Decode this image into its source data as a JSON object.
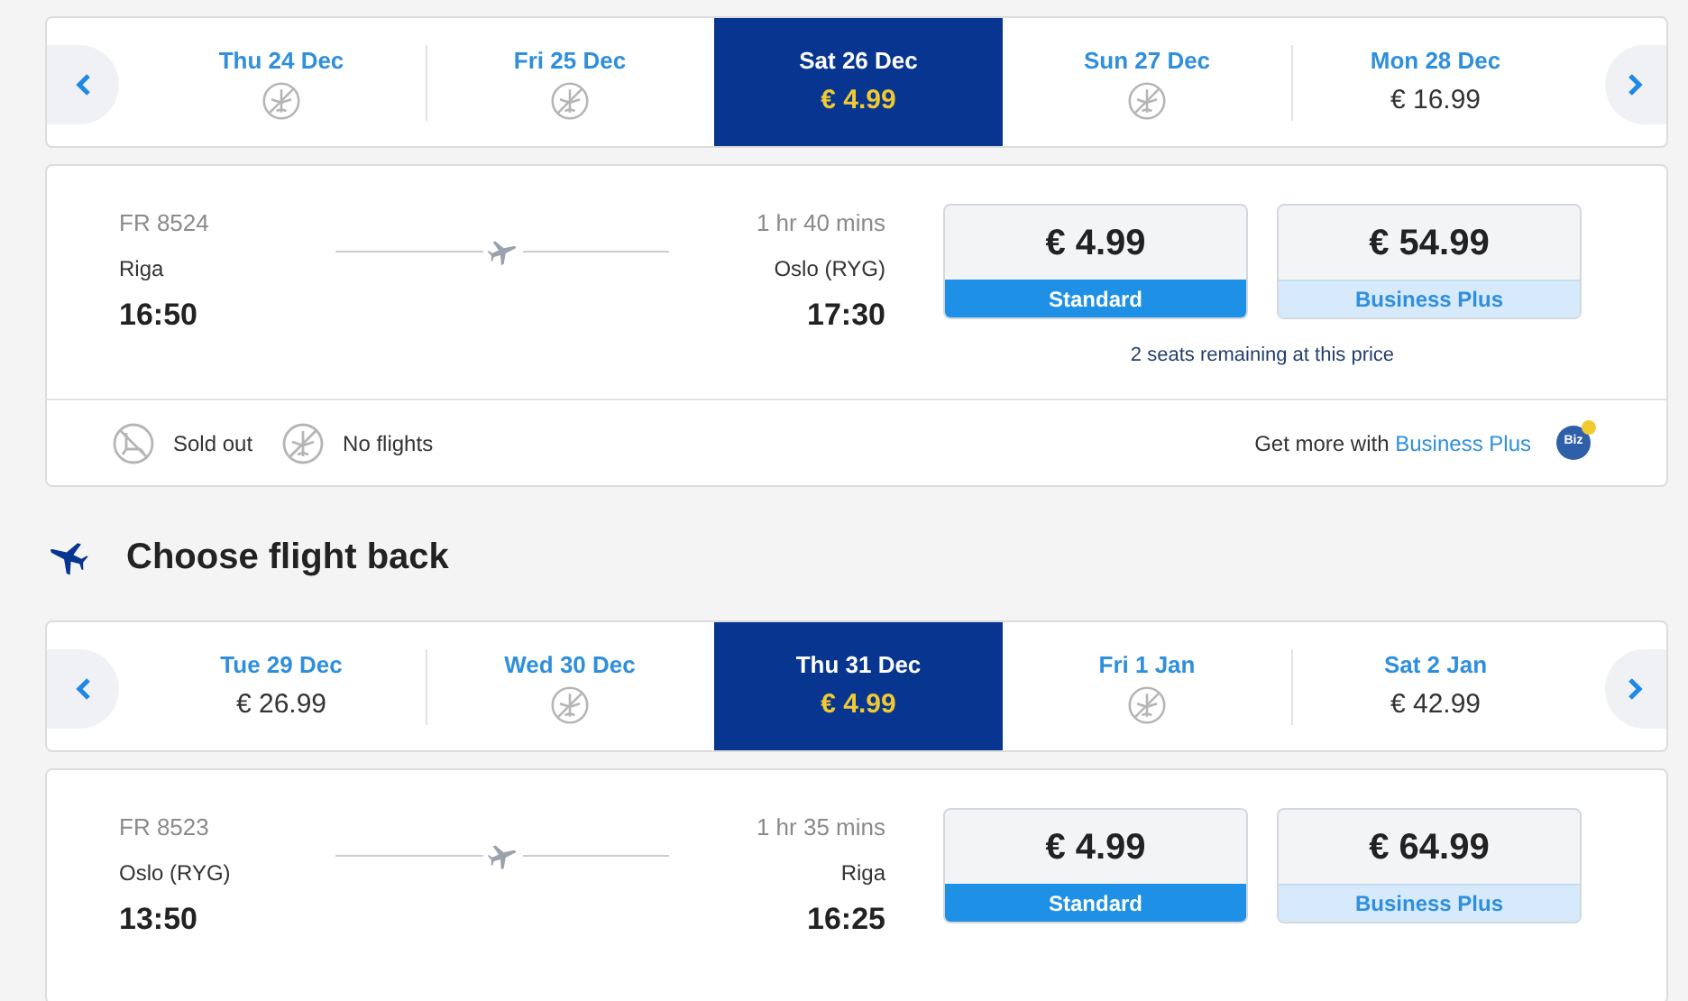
{
  "outbound": {
    "days": [
      {
        "label": "Thu 24 Dec",
        "kind": "no_flights",
        "selected": false
      },
      {
        "label": "Fri 25 Dec",
        "kind": "no_flights",
        "selected": false
      },
      {
        "label": "Sat 26 Dec",
        "kind": "price",
        "price": "€ 4.99",
        "selected": true
      },
      {
        "label": "Sun 27 Dec",
        "kind": "no_flights",
        "selected": false
      },
      {
        "label": "Mon 28 Dec",
        "kind": "price",
        "price": "€ 16.99",
        "selected": false
      }
    ],
    "flight": {
      "number": "FR 8524",
      "duration": "1 hr 40 mins",
      "from": "Riga",
      "to": "Oslo (RYG)",
      "depart": "16:50",
      "arrive": "17:30",
      "fares": [
        {
          "price": "€ 4.99",
          "label": "Standard",
          "selected": true
        },
        {
          "price": "€ 54.99",
          "label": "Business Plus",
          "selected": false
        }
      ],
      "note": "2 seats remaining at this price"
    },
    "legend": [
      {
        "kind": "sold_out",
        "label": "Sold out"
      },
      {
        "kind": "no_flights",
        "label": "No flights"
      }
    ],
    "promo": {
      "text": "Get more with",
      "link": "Business Plus",
      "badge": "Biz"
    }
  },
  "return_heading": "Choose flight back",
  "return": {
    "days": [
      {
        "label": "Tue 29 Dec",
        "kind": "price",
        "price": "€ 26.99",
        "selected": false
      },
      {
        "label": "Wed 30 Dec",
        "kind": "no_flights",
        "selected": false
      },
      {
        "label": "Thu 31 Dec",
        "kind": "price",
        "price": "€ 4.99",
        "selected": true
      },
      {
        "label": "Fri 1 Jan",
        "kind": "no_flights",
        "selected": false
      },
      {
        "label": "Sat 2 Jan",
        "kind": "price",
        "price": "€ 42.99",
        "selected": false
      }
    ],
    "flight": {
      "number": "FR 8523",
      "duration": "1 hr 35 mins",
      "from": "Oslo (RYG)",
      "to": "Riga",
      "depart": "13:50",
      "arrive": "16:25",
      "fares": [
        {
          "price": "€ 4.99",
          "label": "Standard",
          "selected": true
        },
        {
          "price": "€ 64.99",
          "label": "Business Plus",
          "selected": false
        }
      ]
    }
  }
}
